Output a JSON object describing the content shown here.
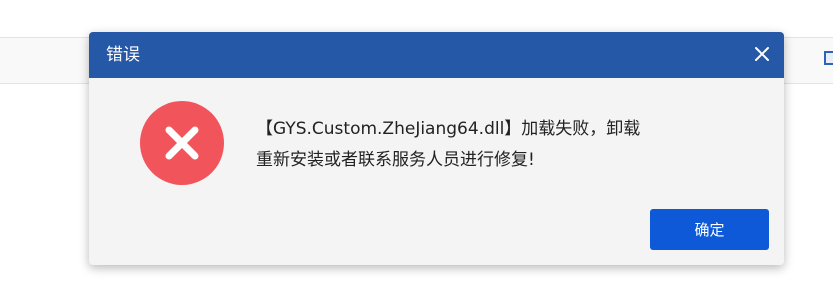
{
  "dialog": {
    "title": "错误",
    "close_icon": "close-icon",
    "status_icon": "error-x-icon",
    "message_line1": "【GYS.Custom.ZheJiang64.dll】加载失败，卸载",
    "message_line2": "重新安装或者联系服务人员进行修复!",
    "ok_label": "确定"
  },
  "colors": {
    "titlebar": "#2558a6",
    "dialog_body": "#f4f4f4",
    "error_icon": "#f2545b",
    "button": "#0d59d8"
  }
}
